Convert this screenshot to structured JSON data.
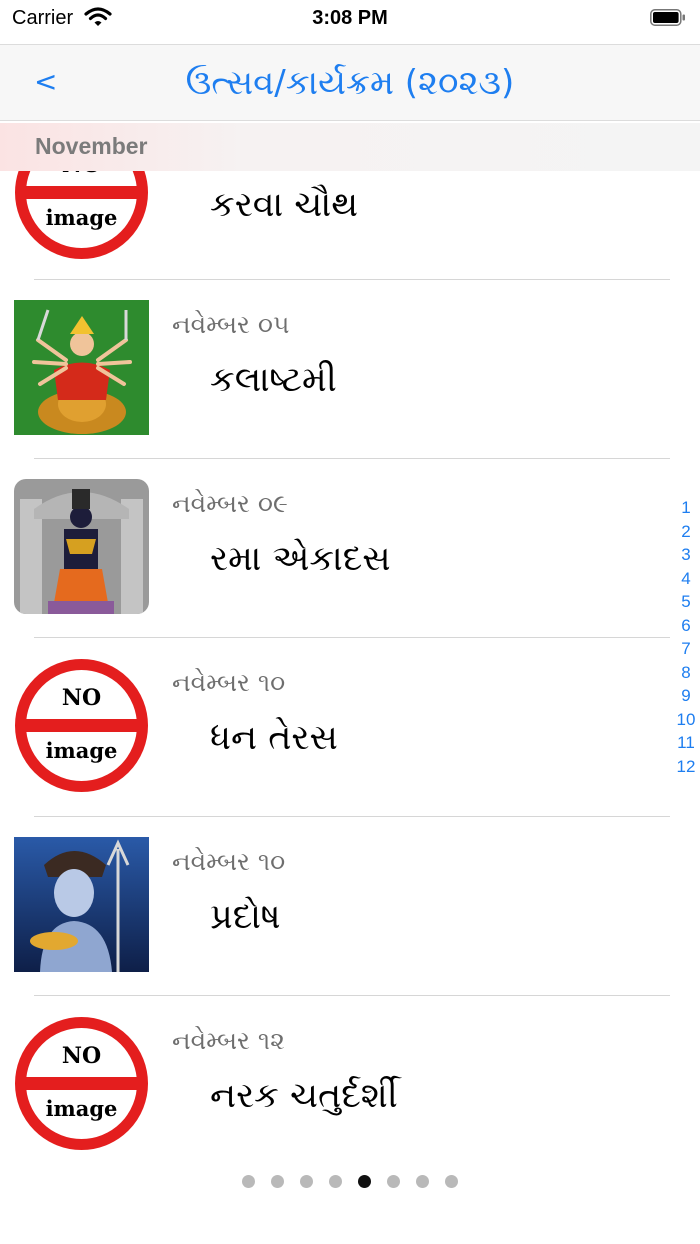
{
  "status_bar": {
    "carrier": "Carrier",
    "time": "3:08 PM"
  },
  "nav": {
    "back_label": "<",
    "title": "ઉત્સવ/કાર્યક્રમ (૨૦૨૩)"
  },
  "section": {
    "label": "November"
  },
  "events": [
    {
      "date": "",
      "name": "કરવા ચૌથ",
      "image": "no-image"
    },
    {
      "date": "નવેમ્બર ૦૫",
      "name": "કલાષ્ટમી",
      "image": "durga"
    },
    {
      "date": "નવેમ્બર ૦૯",
      "name": "રમા એકાદસ",
      "image": "vithoba"
    },
    {
      "date": "નવેમ્બર ૧૦",
      "name": "ધન તેરસ",
      "image": "no-image"
    },
    {
      "date": "નવેમ્બર ૧૦",
      "name": "પ્રદોષ",
      "image": "shiva"
    },
    {
      "date": "નવેમ્બર ૧૨",
      "name": "નરક ચતુર્દર્શી",
      "image": "no-image"
    }
  ],
  "no_image": {
    "top": "NO",
    "bottom": "image"
  },
  "index": [
    "1",
    "2",
    "3",
    "4",
    "5",
    "6",
    "7",
    "8",
    "9",
    "10",
    "11",
    "12"
  ],
  "pager": {
    "count": 8,
    "active": 5
  },
  "colors": {
    "accent": "#1e7ef0",
    "no_image_red": "#e41e1e"
  }
}
